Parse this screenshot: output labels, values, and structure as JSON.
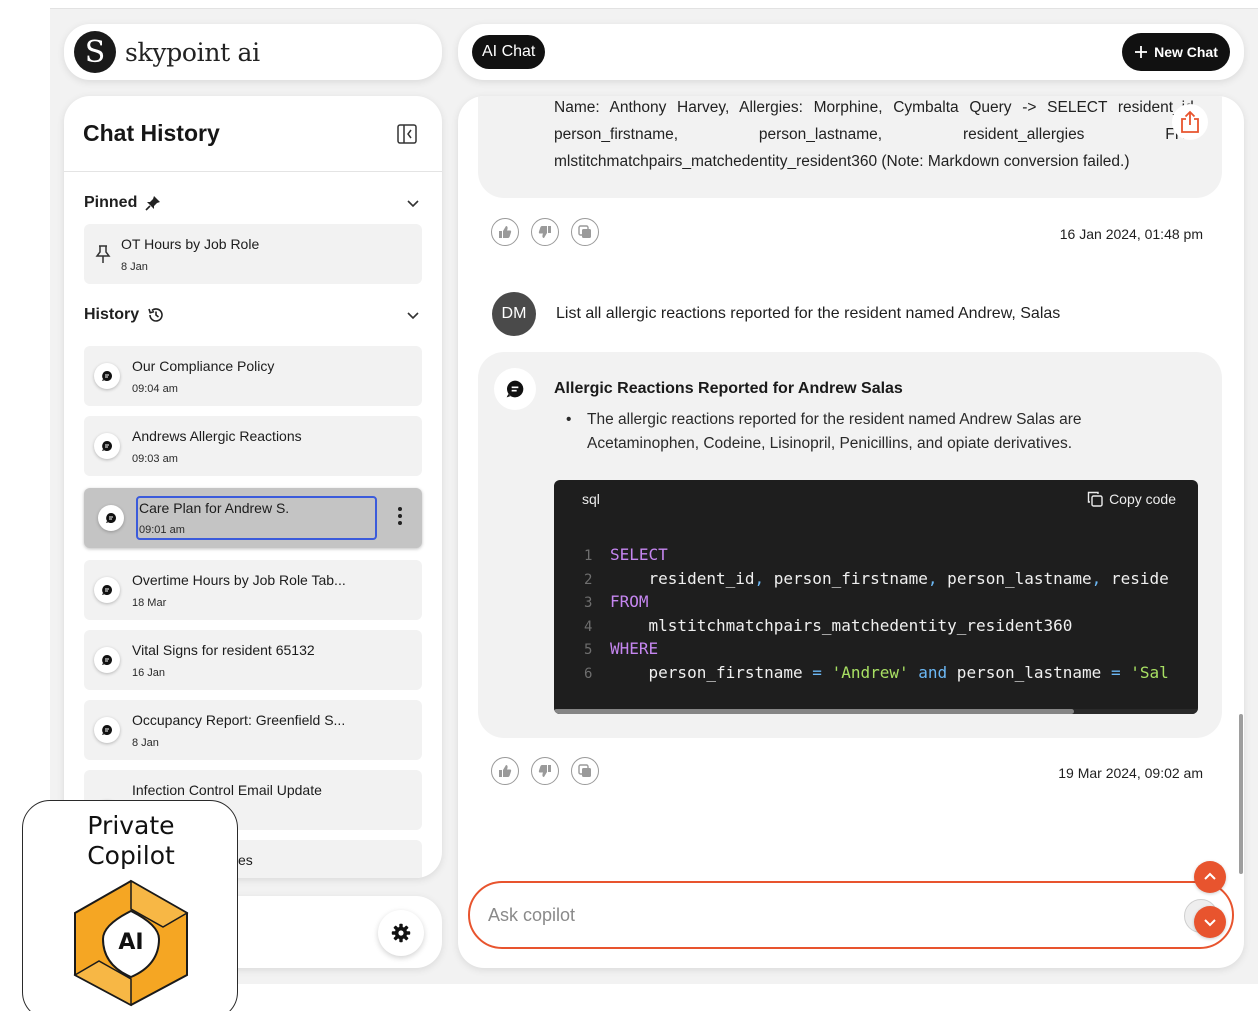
{
  "brand": {
    "name": "skypoint ai"
  },
  "topbar": {
    "ai_chat_label": "AI Chat",
    "new_chat_label": "New Chat"
  },
  "sidebar": {
    "title": "Chat History",
    "pinned": {
      "title": "Pinned",
      "items": [
        {
          "title": "OT Hours by Job Role",
          "date": "8 Jan"
        }
      ]
    },
    "history": {
      "title": "History",
      "items": [
        {
          "title": "Our Compliance Policy",
          "date": "09:04 am"
        },
        {
          "title": "Andrews Allergic Reactions",
          "date": "09:03 am"
        },
        {
          "title": "Care Plan for Andrew S.",
          "date": "09:01 am",
          "selected": true
        },
        {
          "title": "Overtime Hours by Job Role Tab...",
          "date": "18 Mar"
        },
        {
          "title": "Vital Signs for resident 65132",
          "date": "16 Jan"
        },
        {
          "title": "Occupancy Report: Greenfield S...",
          "date": "8 Jan"
        },
        {
          "title": "Infection Control Email Update",
          "date": ""
        },
        {
          "title": "es",
          "date": ""
        }
      ]
    }
  },
  "chat": {
    "previous_response": "Name: Anthony Harvey, Allergies: Morphine, Cymbalta Query -> SELECT resident_id, person_firstname, person_lastname, resident_allergies FRO mlstitchmatchpairs_matchedentity_resident360 (Note: Markdown conversion failed.)",
    "previous_timestamp": "16 Jan 2024, 01:48 pm",
    "user_initials": "DM",
    "user_message": "List all allergic reactions reported for the resident named Andrew, Salas",
    "response": {
      "title": "Allergic Reactions Reported for Andrew Salas",
      "bullet": "The allergic reactions reported for the resident named Andrew Salas are Acetaminophen, Codeine, Lisinopril, Penicillins, and opiate derivatives.",
      "code_language": "sql",
      "copy_label": "Copy code",
      "code_lines": [
        {
          "n": "1",
          "kw": "SELECT"
        },
        {
          "n": "2",
          "indent": "    ",
          "text": "resident_id",
          "c1": ",",
          "t2": " person_firstname",
          "c2": ",",
          "t3": " person_lastname",
          "c3": ",",
          "t4": " reside"
        },
        {
          "n": "3",
          "kw": "FROM"
        },
        {
          "n": "4",
          "indent": "    ",
          "text": "mlstitchmatchpairs_matchedentity_resident360"
        },
        {
          "n": "5",
          "kw": "WHERE"
        },
        {
          "n": "6",
          "indent": "    ",
          "text": "person_firstname ",
          "eq": "=",
          "s1": " 'Andrew'",
          "and": " and",
          "t2": " person_lastname ",
          "eq2": "=",
          "s2": " 'Sal"
        }
      ],
      "timestamp": "19 Mar 2024, 09:02 am"
    },
    "input_placeholder": "Ask copilot"
  },
  "copilot_badge": {
    "line1": "Private",
    "line2": "Copilot",
    "ai_label": "AI"
  },
  "colors": {
    "accent": "#e8542e",
    "dark": "#111111",
    "selection": "#3b5bdb"
  }
}
